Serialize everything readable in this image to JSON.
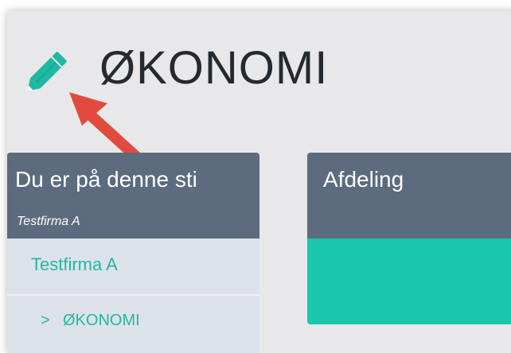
{
  "page": {
    "title": "ØKONOMI",
    "icons": {
      "edit": "pencil-icon",
      "pointer": "arrow-pointer"
    },
    "colors": {
      "accent": "#1fb9a3",
      "panel_header": "#5c6b7e",
      "arrow": "#e14b3e",
      "teal_block": "#18c7ac"
    }
  },
  "breadcrumb_panel": {
    "heading": "Du er på denne sti",
    "subtitle": "Testfirma A",
    "items": [
      {
        "label": "Testfirma A"
      },
      {
        "chevron": ">",
        "label": "ØKONOMI"
      }
    ]
  },
  "department_panel": {
    "heading": "Afdeling"
  }
}
